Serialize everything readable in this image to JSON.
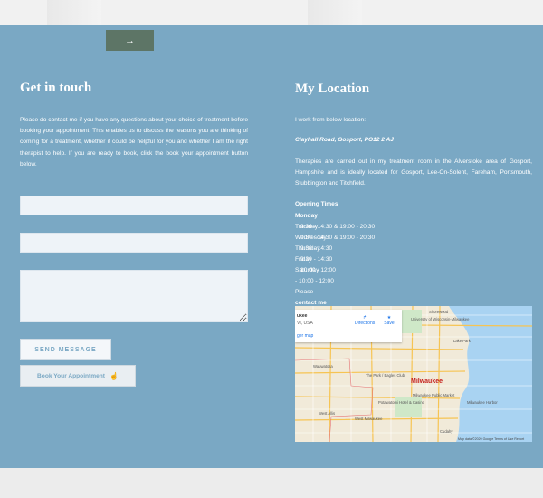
{
  "top_button": {
    "icon": "arrow-right-icon",
    "glyph": "→"
  },
  "contact": {
    "title": "Get in touch",
    "description": "Please do contact me if you have any questions about your choice of treatment before booking your appointment. This enables us to discuss the reasons you are thinking of coming for a treatment, whether it could be helpful for you and whether I am the right therapist to help. If you are ready to book, click the book your appointment button below.",
    "send_label": "SEND MESSAGE",
    "book_label": "Book Your Appointment",
    "book_icon": "pointer-icon"
  },
  "location": {
    "title": "My Location",
    "intro": "I work from below location:",
    "address": "Clayhall Road, Gosport, PO12 2 AJ",
    "body": "Therapies are carried out in my treatment room in the Alverstoke area of Gosport, Hampshire and is ideally located for Gosport, Lee-On-Solent, Fareham, Portsmouth, Stubbington and Titchfield.",
    "hours_title": "Opening Times",
    "hours": [
      {
        "day": "Monday",
        "times": ""
      },
      {
        "day": "Tuesday",
        "times": "9:30 - 14:30 & 19:00 - 20:30"
      },
      {
        "day": "Wednesday",
        "times": "9:30 - 14:30 & 19:00 - 20:30"
      },
      {
        "day": "Thursday",
        "times": "9:30 - 14:30"
      },
      {
        "day": "Friday",
        "times": "9:30 - 14:30"
      },
      {
        "day": "Saturday",
        "times": "10:00 - 12:00"
      },
      {
        "day": "",
        "times": "- 10:00 - 12:00"
      },
      {
        "day": "Please",
        "times": ""
      },
      {
        "day": "contact me",
        "times": ""
      }
    ]
  },
  "map": {
    "card_title": "ukee",
    "card_sub": "VI, USA",
    "card_link": "ger map",
    "directions": "Directions",
    "save": "Save",
    "city": "Milwaukee",
    "labels": [
      "University of Wisconsin-Milwaukee",
      "Shorewood",
      "Lake Park",
      "Wauwatosa",
      "The Park / Eagles Club",
      "Milwaukee Public Market",
      "Potawatomi Hotel & Casino",
      "West Allis",
      "West Milwaukee",
      "Milwaukee Harbor",
      "Cudahy"
    ],
    "footer": "Map data ©2020 Google   Terms of Use   Report"
  },
  "colors": {
    "section_bg": "#7aa8c4",
    "arrow_button": "#5d7566",
    "field_bg": "#eef3f8",
    "map_water": "#a9d3f2"
  }
}
